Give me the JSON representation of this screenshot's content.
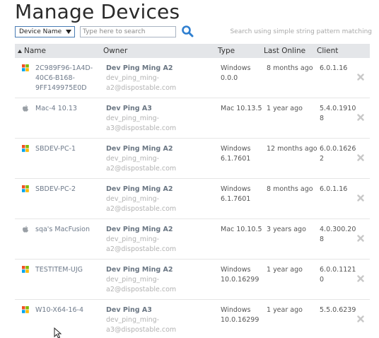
{
  "page": {
    "title": "Manage Devices"
  },
  "search": {
    "field_selected": "Device Name",
    "placeholder": "Type here to search",
    "hint": "Search using simple string pattern matching"
  },
  "table": {
    "columns": [
      "Name",
      "Owner",
      "Type",
      "Last Online",
      "Client"
    ],
    "rows": [
      {
        "os_icon": "windows-icon",
        "name": "2C989F96-1A4D-40C6-B168-9FF149975E0D",
        "owner": "Dev Ping Ming A2",
        "owner_email": "dev_ping_ming-a2@dispostable.com",
        "type": "Windows 0.0.0",
        "last_online": "8 months ago",
        "client": "6.0.1.16"
      },
      {
        "os_icon": "apple-icon",
        "name": "Mac-4 10.13",
        "owner": "Dev Ping A3",
        "owner_email": "dev_ping_ming-a3@dispostable.com",
        "type": "Mac 10.13.5",
        "last_online": "1 year ago",
        "client": "5.4.0.19108"
      },
      {
        "os_icon": "windows-icon",
        "name": "SBDEV-PC-1",
        "owner": "Dev Ping Ming A2",
        "owner_email": "dev_ping_ming-a2@dispostable.com",
        "type": "Windows 6.1.7601",
        "last_online": "12 months ago",
        "client": "6.0.0.16262"
      },
      {
        "os_icon": "windows-icon",
        "name": "SBDEV-PC-2",
        "owner": "Dev Ping Ming A2",
        "owner_email": "dev_ping_ming-a2@dispostable.com",
        "type": "Windows 6.1.7601",
        "last_online": "8 months ago",
        "client": "6.0.1.16"
      },
      {
        "os_icon": "apple-icon",
        "name": "sqa's MacFusion",
        "owner": "Dev Ping Ming A2",
        "owner_email": "dev_ping_ming-a2@dispostable.com",
        "type": "Mac 10.10.5",
        "last_online": "3 years ago",
        "client": "4.0.300.208"
      },
      {
        "os_icon": "windows-icon",
        "name": "TESTITEM-UJG",
        "owner": "Dev Ping Ming A2",
        "owner_email": "dev_ping_ming-a2@dispostable.com",
        "type": "Windows 10.0.16299",
        "last_online": "1 year ago",
        "client": "6.0.0.11210"
      },
      {
        "os_icon": "windows-icon",
        "name": "W10-X64-16-4",
        "owner": "Dev Ping A3",
        "owner_email": "dev_ping_ming-a3@dispostable.com",
        "type": "Windows 10.0.16299",
        "last_online": "1 year ago",
        "client": "5.5.0.6239"
      }
    ]
  },
  "colors": {
    "accent": "#2f7fd0",
    "header_bg": "#e4e6e9",
    "owner_name": "#6a7683",
    "muted": "#b2b2b2"
  }
}
